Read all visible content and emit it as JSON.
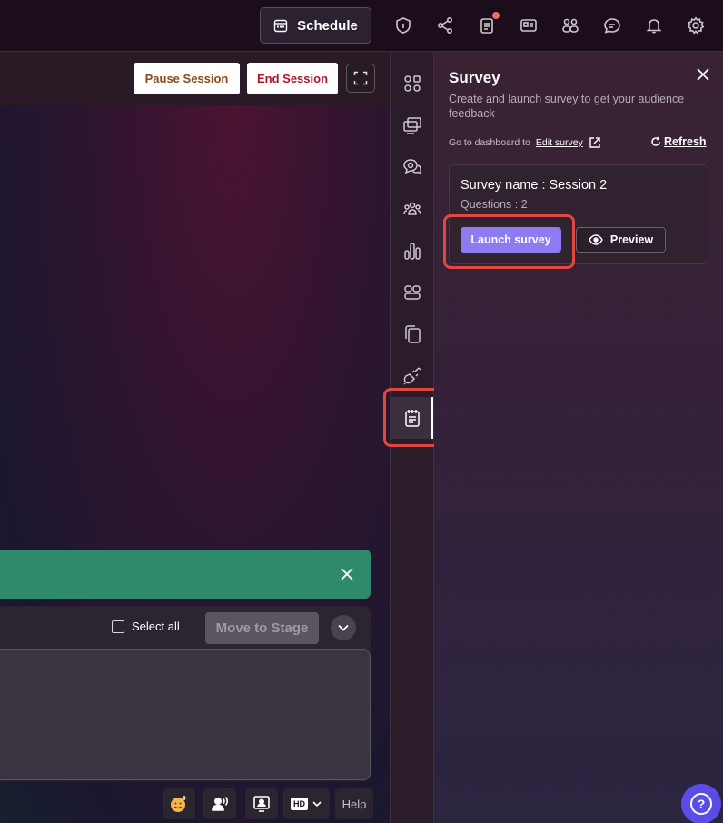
{
  "topbar": {
    "schedule_label": "Schedule",
    "icons": [
      "shield-icon",
      "share-icon",
      "notes-icon",
      "contact-card-icon",
      "people-icon",
      "chat-icon",
      "bell-icon",
      "gear-icon"
    ]
  },
  "stage": {
    "pause_label": "Pause Session",
    "end_label": "End Session",
    "select_all_label": "Select all",
    "move_to_stage_label": "Move to Stage",
    "help_label": "Help",
    "hd_label": "HD"
  },
  "panel": {
    "title": "Survey",
    "subtitle": "Create and launch survey to get your audience feedback",
    "dashboard_prefix": "Go to dashboard to",
    "edit_survey_label": "Edit survey",
    "refresh_label": "Refresh",
    "survey": {
      "name": "Survey name : Session 2",
      "questions": "Questions : 2",
      "launch_label": "Launch survey",
      "preview_label": "Preview"
    }
  },
  "rail": {
    "icons": [
      "apps-icon",
      "presentation-icon",
      "qa-chat-icon",
      "audience-icon",
      "poll-chart-icon",
      "layout-icon",
      "files-icon",
      "plug-icon",
      "survey-icon"
    ],
    "active": "survey-icon"
  },
  "colors": {
    "accent": "#8c7cf0",
    "highlight": "#e0473e",
    "banner": "#2f8a6c",
    "end_session": "#b0142b",
    "pause_session": "#8a4a1d"
  }
}
